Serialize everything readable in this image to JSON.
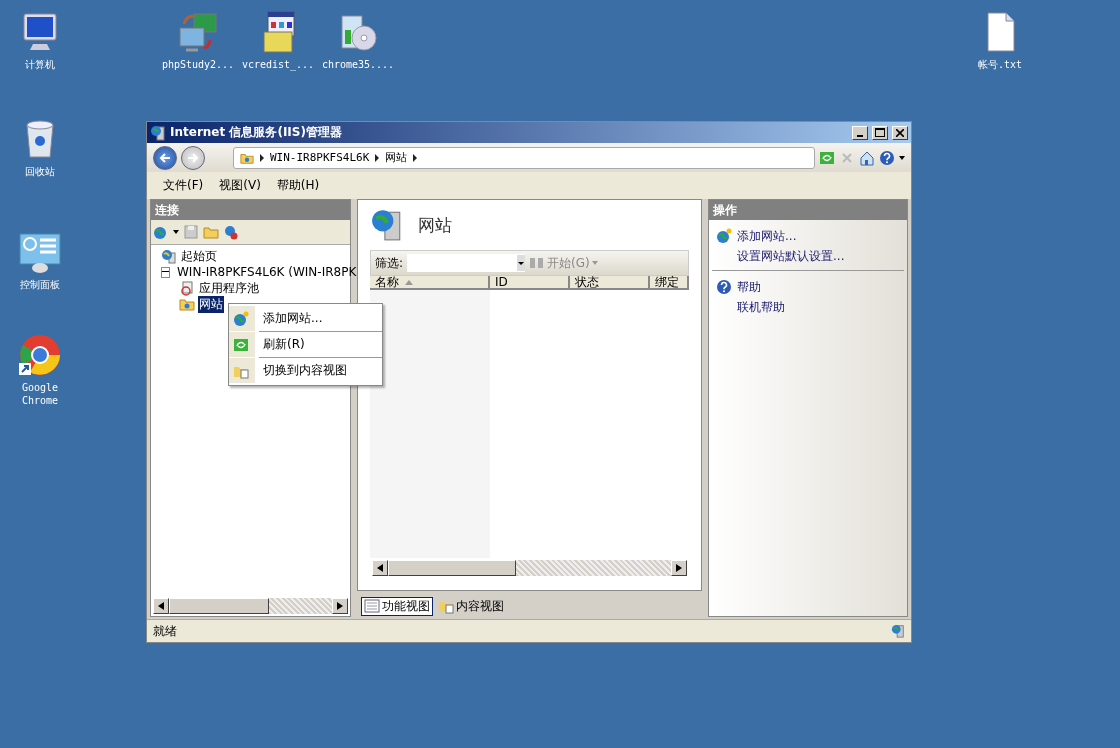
{
  "desktop_icons": [
    {
      "label": "计算机",
      "kind": "computer"
    },
    {
      "label": "phpStudy2...",
      "kind": "transfer"
    },
    {
      "label": "vcredist_...",
      "kind": "package"
    },
    {
      "label": "chrome35....",
      "kind": "disc"
    },
    {
      "label": "帐号.txt",
      "kind": "document"
    },
    {
      "label": "回收站",
      "kind": "recycle"
    },
    {
      "label": "控制面板",
      "kind": "panel"
    },
    {
      "label": "Google Chrome",
      "kind": "browser"
    }
  ],
  "window": {
    "title": "Internet 信息服务(IIS)管理器",
    "address": [
      "WIN-IR8PKFS4L6K",
      "网站"
    ],
    "menu": [
      "文件(F)",
      "视图(V)",
      "帮助(H)"
    ],
    "connections": {
      "title": "连接",
      "tree": [
        {
          "label": "起始页",
          "kind": "start",
          "selected": false
        },
        {
          "label": "WIN-IR8PKFS4L6K (WIN-IR8PK",
          "kind": "server",
          "selected": false,
          "expanded": true,
          "children": [
            {
              "label": "应用程序池",
              "kind": "pool",
              "selected": false
            },
            {
              "label": "网站",
              "kind": "sites",
              "selected": true
            }
          ]
        }
      ]
    },
    "content": {
      "title": "网站",
      "filter_label": "筛选:",
      "start_button": "开始(G)",
      "columns": [
        "名称",
        "ID",
        "状态",
        "绑定"
      ],
      "views": [
        {
          "label": "功能视图",
          "kind": "feature",
          "selected": true
        },
        {
          "label": "内容视图",
          "kind": "content",
          "selected": false
        }
      ]
    },
    "actions": {
      "title": "操作",
      "groups": [
        [
          {
            "label": "添加网站...",
            "kind": "add"
          },
          {
            "label": "设置网站默认设置...",
            "kind": "plain"
          }
        ],
        [
          {
            "label": "帮助",
            "kind": "help"
          },
          {
            "label": "联机帮助",
            "kind": "plain"
          }
        ]
      ]
    },
    "status": "就绪"
  },
  "context_menu": [
    {
      "label": "添加网站...",
      "kind": "add"
    },
    {
      "label": "刷新(R)",
      "kind": "refresh"
    },
    {
      "label": "切换到内容视图",
      "kind": "content"
    }
  ]
}
